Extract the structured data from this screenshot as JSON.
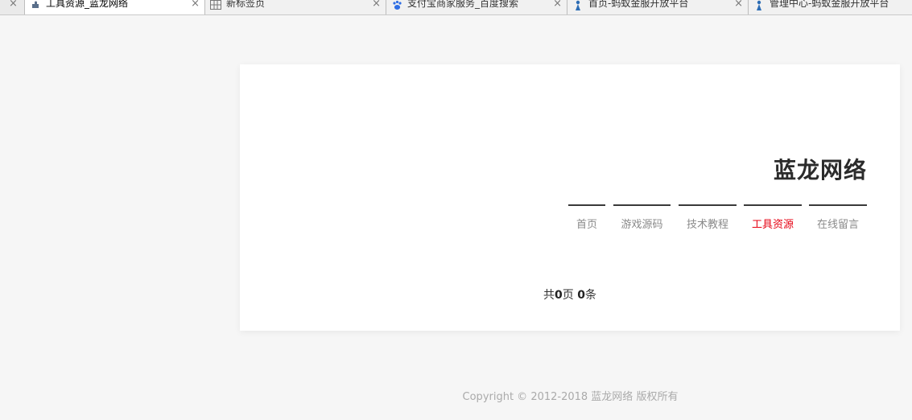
{
  "browser": {
    "tabs": [
      {
        "label": "工具资源_蓝龙网络",
        "icon": "puzzle-icon",
        "active": true
      },
      {
        "label": "新标签页",
        "icon": "grid-icon",
        "active": false
      },
      {
        "label": "支付宝商家服务_百度搜索",
        "icon": "baidu-paw-icon",
        "active": false
      },
      {
        "label": "首页-蚂蚁金服开放平台",
        "icon": "ant-icon",
        "active": false
      },
      {
        "label": "管理中心-蚂蚁金服开放平台",
        "icon": "ant-icon",
        "active": false
      }
    ],
    "close_glyph": "×"
  },
  "site": {
    "title": "蓝龙网络",
    "nav": [
      "首页",
      "游戏源码",
      "技术教程",
      "工具资源",
      "在线留言"
    ],
    "active_nav": "工具资源",
    "accent": "#e60012"
  },
  "pager": {
    "prefix": "共",
    "pages": "0",
    "pages_unit": "页",
    "items": "0",
    "items_unit": "条"
  },
  "footer": {
    "text": "Copyright © 2012-2018 蓝龙网络 版权所有"
  }
}
